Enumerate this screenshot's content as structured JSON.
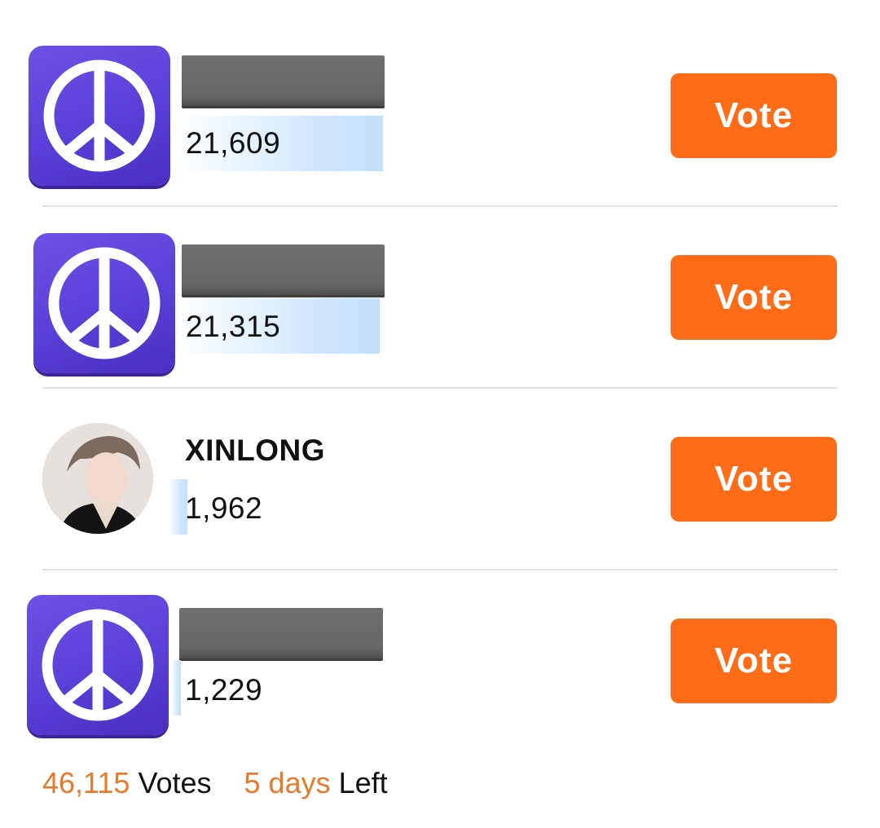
{
  "candidates": [
    {
      "name": "",
      "votes": "21,609",
      "bar_fraction": 1.0,
      "avatar": "peace-icon"
    },
    {
      "name": "",
      "votes": "21,315",
      "bar_fraction": 0.986,
      "avatar": "peace-icon"
    },
    {
      "name": "XINLONG",
      "votes": "1,962",
      "bar_fraction": 0.091,
      "avatar": "photo"
    },
    {
      "name": "",
      "votes": "1,229",
      "bar_fraction": 0.057,
      "avatar": "peace-icon"
    }
  ],
  "vote_button_label": "Vote",
  "footer": {
    "total_votes": "46,115",
    "votes_label": "Votes",
    "days": "5 days",
    "left_label": "Left"
  },
  "colors": {
    "accent": "#ff6c17",
    "footer_highlight": "#e8782a",
    "icon_purple": "#5a3fd8",
    "bar_blue": "#cfe6fd",
    "redaction_gray": "#6f6f6f"
  }
}
